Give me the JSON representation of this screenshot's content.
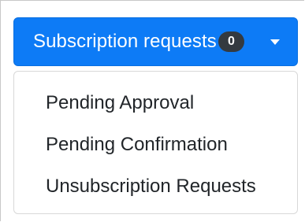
{
  "dropdown": {
    "label": "Subscription requests",
    "badge_count": "0",
    "caret_icon": "caret-down-icon",
    "accent_color": "#0d7bf6",
    "badge_color": "#343a40"
  },
  "menu": {
    "items": [
      {
        "label": "Pending Approval"
      },
      {
        "label": "Pending Confirmation"
      },
      {
        "label": "Unsubscription Requests"
      }
    ]
  }
}
